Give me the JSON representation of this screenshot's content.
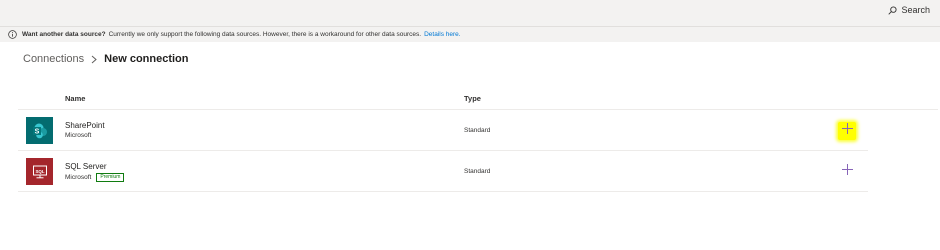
{
  "header": {
    "search_label": "Search"
  },
  "banner": {
    "title": "Want another data source?",
    "text": "Currently we only support the following data sources. However, there is a workaround for other data sources.",
    "link": "Details here."
  },
  "breadcrumb": {
    "parent": "Connections",
    "current": "New connection"
  },
  "table": {
    "columns": {
      "name": "Name",
      "type": "Type"
    },
    "rows": [
      {
        "name": "SharePoint",
        "publisher": "Microsoft",
        "badge": "",
        "type": "Standard",
        "icon": "sharepoint-icon",
        "icon_color": "#036c70"
      },
      {
        "name": "SQL Server",
        "publisher": "Microsoft",
        "badge": "Premium",
        "type": "Standard",
        "icon": "sql-server-icon",
        "icon_color": "#a4262c"
      }
    ]
  },
  "colors": {
    "accent": "#0078d4",
    "add_icon": "#8764b8",
    "highlight": "#ffff00",
    "premium": "#107c10"
  }
}
